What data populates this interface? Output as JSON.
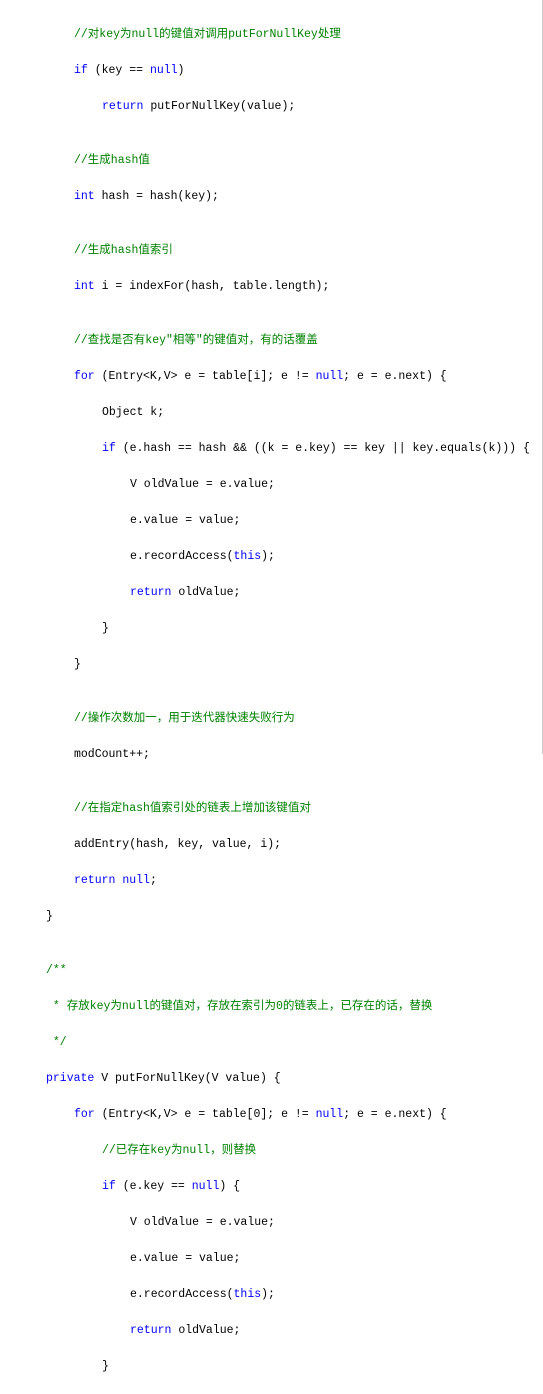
{
  "code": {
    "l01": "//对key为null的键值对调用putForNullKey处理",
    "l02a": "if",
    "l02b": " (key == ",
    "l02c": "null",
    "l02d": ")",
    "l03a": "return",
    "l03b": " putForNullKey(value);",
    "l04": "",
    "l05": "//生成hash值",
    "l06a": "int",
    "l06b": " hash = hash(key);",
    "l07": "",
    "l08": "//生成hash值索引",
    "l09a": "int",
    "l09b": " i = indexFor(hash, table.length);",
    "l10": "",
    "l11": "//查找是否有key\"相等\"的键值对，有的话覆盖",
    "l12a": "for",
    "l12b": " (Entry<K,V> e = table[i]; e != ",
    "l12c": "null",
    "l12d": "; e = e.next) {",
    "l13": "Object k;",
    "l14a": "if",
    "l14b": " (e.hash == hash && ((k = e.key) == key || key.equals(k))) {",
    "l15": "V oldValue = e.value;",
    "l16": "e.value = value;",
    "l17a": "e.recordAccess(",
    "l17b": "this",
    "l17c": ");",
    "l18a": "return",
    "l18b": " oldValue;",
    "l19": "}",
    "l20": "}",
    "l21": "",
    "l22": "//操作次数加一，用于迭代器快速失败行为",
    "l23": "modCount++;",
    "l24": "",
    "l25": "//在指定hash值索引处的链表上增加该键值对",
    "l26": "addEntry(hash, key, value, i);",
    "l27a": "return",
    "l27b": " ",
    "l27c": "null",
    "l27d": ";",
    "l28": "}",
    "l29": "",
    "l30": "/**",
    "l31": " * 存放key为null的键值对，存放在索引为0的链表上，已存在的话，替换",
    "l32": " */",
    "l33a": "private",
    "l33b": " V putForNullKey(V value) {",
    "l34a": "for",
    "l34b": " (Entry<K,V> e = table[",
    "l34c": "0",
    "l34d": "]; e != ",
    "l34e": "null",
    "l34f": "; e = e.next) {",
    "l35": "//已存在key为null，则替换",
    "l36a": "if",
    "l36b": " (e.key == ",
    "l36c": "null",
    "l36d": ") {",
    "l37": "V oldValue = e.value;",
    "l38": "e.value = value;",
    "l39a": "e.recordAccess(",
    "l39b": "this",
    "l39c": ");",
    "l40a": "return",
    "l40b": " oldValue;",
    "l41": "}"
  }
}
